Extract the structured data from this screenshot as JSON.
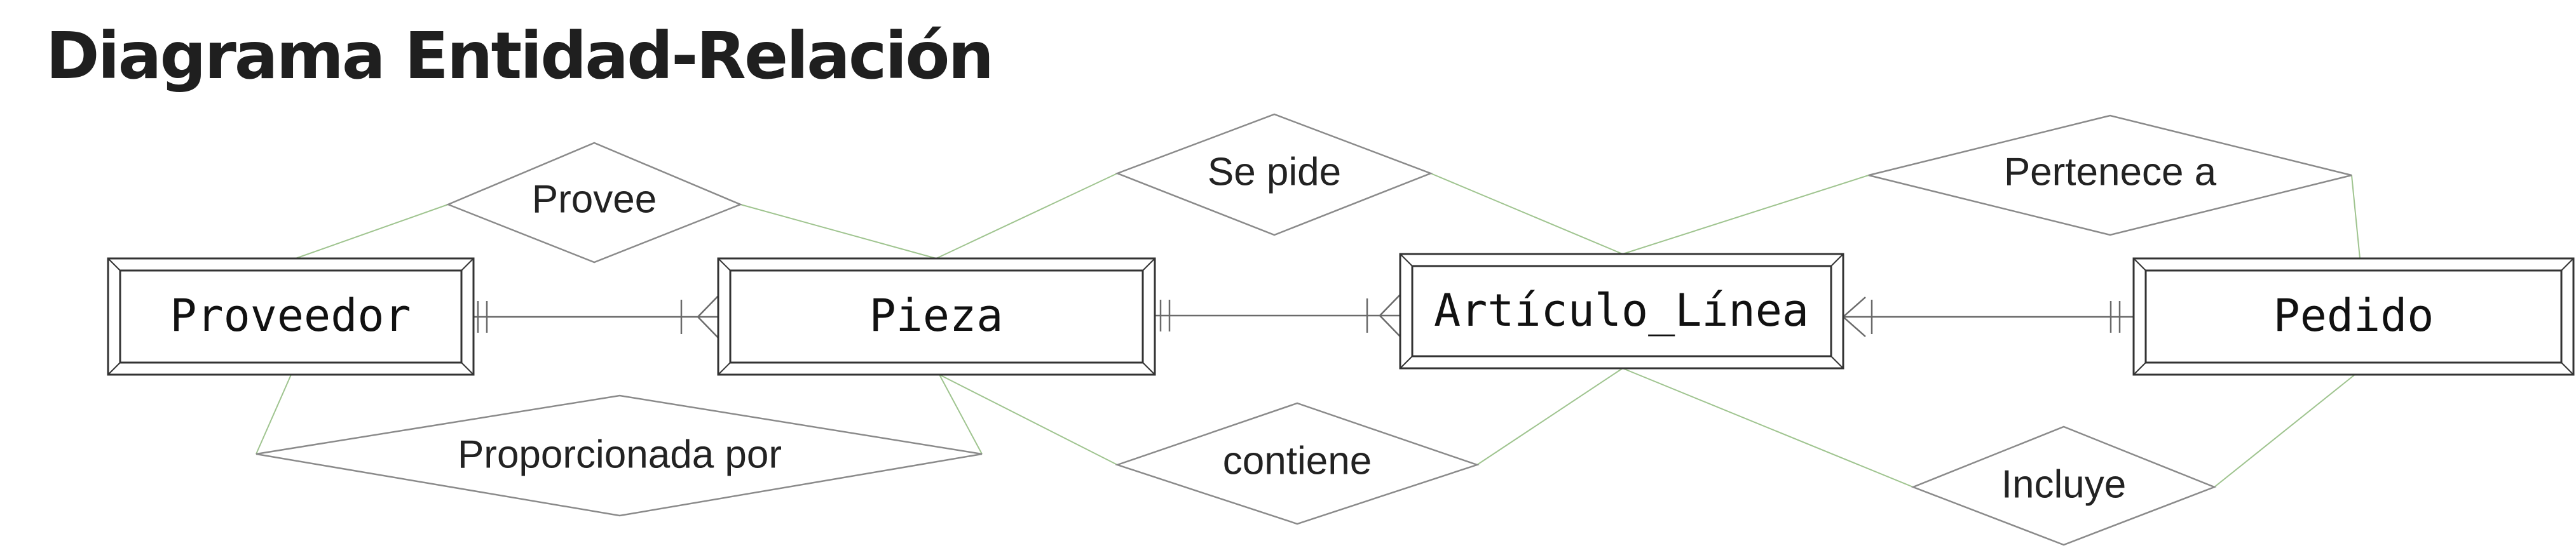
{
  "title": "Diagrama Entidad-Relación",
  "colors": {
    "stroke": "#333333",
    "connector": "#9fc48f",
    "diamond": "#8a8a8a",
    "title": "#1f1f1f"
  },
  "entities": {
    "proveedor": "Proveedor",
    "pieza": "Pieza",
    "articulo_linea": "Artículo_Línea",
    "pedido": "Pedido"
  },
  "relationships": {
    "provee": "Provee",
    "proporcionada_por": "Proporcionada por",
    "se_pide": "Se pide",
    "contiene": "contiene",
    "pertenece_a": "Pertenece a",
    "incluye": "Incluye"
  }
}
